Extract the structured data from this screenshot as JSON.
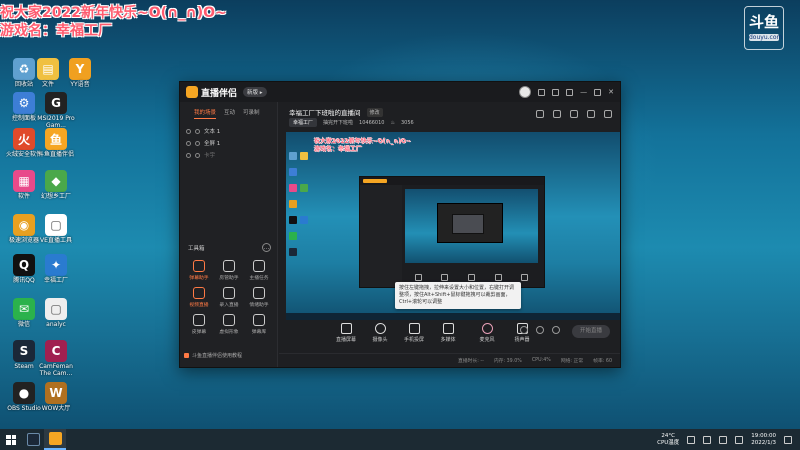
{
  "overlay": {
    "line1": "祝大家2022新年快乐~O(∩_∩)O~",
    "line2": "游戏名：幸福工厂"
  },
  "watermark": {
    "main": "斗鱼",
    "sub": "douyu.com"
  },
  "desktop_icons": [
    {
      "label": "回收站",
      "color": "#5fa0d0",
      "glyph": "♻"
    },
    {
      "label": "文件",
      "color": "#f0c040",
      "glyph": "▤"
    },
    {
      "label": "YY语音",
      "color": "#f0a020",
      "glyph": "Y"
    },
    {
      "label": "控制面板",
      "color": "#3d7ed6",
      "glyph": "⚙"
    },
    {
      "label": "MSI2019 Pro Gam...",
      "color": "#222",
      "glyph": "G"
    },
    {
      "label": "火绒安全软件",
      "color": "#e04a2a",
      "glyph": "火"
    },
    {
      "label": "斗鱼直播伴侣",
      "color": "#f6a623",
      "glyph": "鱼"
    },
    {
      "label": "软件",
      "color": "#e84a8a",
      "glyph": "▦"
    },
    {
      "label": "幻想乡工厂",
      "color": "#4aa84a",
      "glyph": "◆"
    },
    {
      "label": "极速浏览器",
      "color": "#e8a020",
      "glyph": "◉"
    },
    {
      "label": "VE直播工具",
      "color": "#fff",
      "glyph": "▢"
    },
    {
      "label": "腾讯QQ",
      "color": "#111",
      "glyph": "Q"
    },
    {
      "label": "幸福工厂",
      "color": "#2a7bd0",
      "glyph": "✦"
    },
    {
      "label": "微信",
      "color": "#2bb24c",
      "glyph": "✉"
    },
    {
      "label": "analyc",
      "color": "#eee",
      "glyph": "▢"
    },
    {
      "label": "Steam",
      "color": "#1b2838",
      "glyph": "S"
    },
    {
      "label": "CamFeman The Cam...",
      "color": "#a02050",
      "glyph": "C"
    },
    {
      "label": "OBS Studio",
      "color": "#222",
      "glyph": "●"
    },
    {
      "label": "WOW大厅",
      "color": "#b07020",
      "glyph": "W"
    }
  ],
  "app": {
    "name": "直播伴侣",
    "version_pill": "新版 ▸",
    "sidebar_tabs": [
      "我的场景",
      "互动",
      "可录制"
    ],
    "scenes": [
      {
        "label": "文本 1"
      },
      {
        "label": "全屏 1"
      },
      {
        "label": "卡宇"
      }
    ],
    "tools_title": "工具箱",
    "tools": [
      {
        "label": "弹幕助手",
        "hot": true
      },
      {
        "label": "房管助手",
        "hot": false
      },
      {
        "label": "主播任务",
        "hot": false
      },
      {
        "label": "视频直播",
        "hot": true
      },
      {
        "label": "录入直播",
        "hot": false
      },
      {
        "label": "情绪助手",
        "hot": false
      },
      {
        "label": "皮弹幕",
        "hot": false
      },
      {
        "label": "虚拟形象",
        "hot": false
      },
      {
        "label": "弹幕库",
        "hot": false
      }
    ],
    "sidebar_footer": "斗鱼直播伴侣使用教程",
    "room_title": "幸福工厂下班啦的直播间",
    "edit_label": "修改",
    "category": "幸福工厂",
    "room_info": "抽完开下班啦",
    "room_id": "10466010",
    "hot_count": "3056",
    "preview_text": "祝大家2022新年快乐~O(∩_∩)O~",
    "preview_text2": "游戏名：幸福工厂",
    "tooltip": "按住左键拖拽，拉伸来设置大小和位置，右键打开调整项，按住Alt+Shift+鼠标键拖拽可以裁剪画面，Ctrl+滚轮可以调整",
    "controls": [
      {
        "label": "直播屏幕",
        "icon": "monitor-icon"
      },
      {
        "label": "摄像头",
        "icon": "camera-icon"
      },
      {
        "label": "手机投屏",
        "icon": "phone-icon"
      },
      {
        "label": "多媒体",
        "icon": "media-icon"
      },
      {
        "label": "麦克风",
        "icon": "mic-icon"
      },
      {
        "label": "扬声器",
        "icon": "speaker-icon"
      }
    ],
    "start_button": "开始直播",
    "status": [
      "直播时长: --",
      "内存: 39.0%",
      "CPU:4%",
      "网络: 正常",
      "帧率: 60"
    ]
  },
  "taskbar": {
    "weather_temp": "24°C",
    "weather_desc": "CPU温度",
    "time": "19:00:00",
    "date": "2022/1/3"
  }
}
